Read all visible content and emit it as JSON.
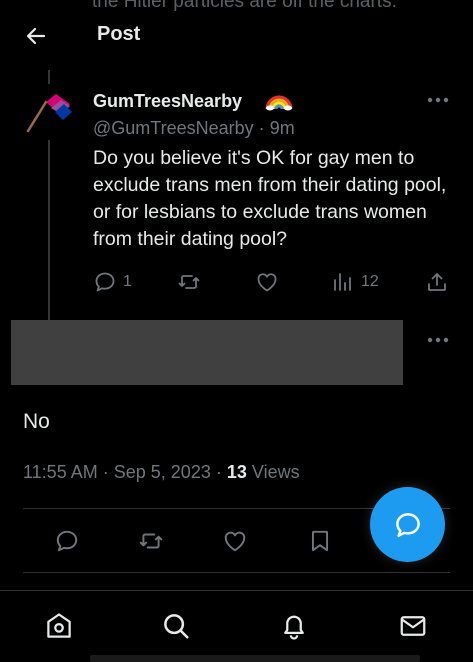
{
  "top_ghost_text": "the Hitler particles are off the charts.",
  "header": {
    "title": "Post"
  },
  "tweet": {
    "display_name": "GumTreesNearby",
    "handle": "@GumTreesNearby",
    "separator": "·",
    "age": "9m",
    "text": "Do you believe it's OK for gay men to exclude trans men from their dating pool, or for lesbians to exclude trans women from their dating pool?",
    "reply_count": "1",
    "view_count": "12"
  },
  "reply": {
    "text": "No",
    "time": "11:55 AM",
    "separator": "·",
    "date": "Sep 5, 2023",
    "separator2": "·",
    "views": "13",
    "views_label": "Views"
  },
  "colors": {
    "background": "#000000",
    "text": "#e7e9ea",
    "muted": "#71767b",
    "accent": "#1d9bf0",
    "redaction": "#404040"
  },
  "icons": {
    "back": "arrow-left-icon",
    "more": "more-dots-icon",
    "reply": "speech-bubble-icon",
    "retweet": "retweet-icon",
    "like": "heart-icon",
    "views": "bar-chart-icon",
    "share": "share-upload-icon",
    "bookmark": "bookmark-icon",
    "compose": "compose-reply-icon",
    "home": "home-icon",
    "search": "search-icon",
    "notifications": "bell-icon",
    "messages": "envelope-icon"
  }
}
